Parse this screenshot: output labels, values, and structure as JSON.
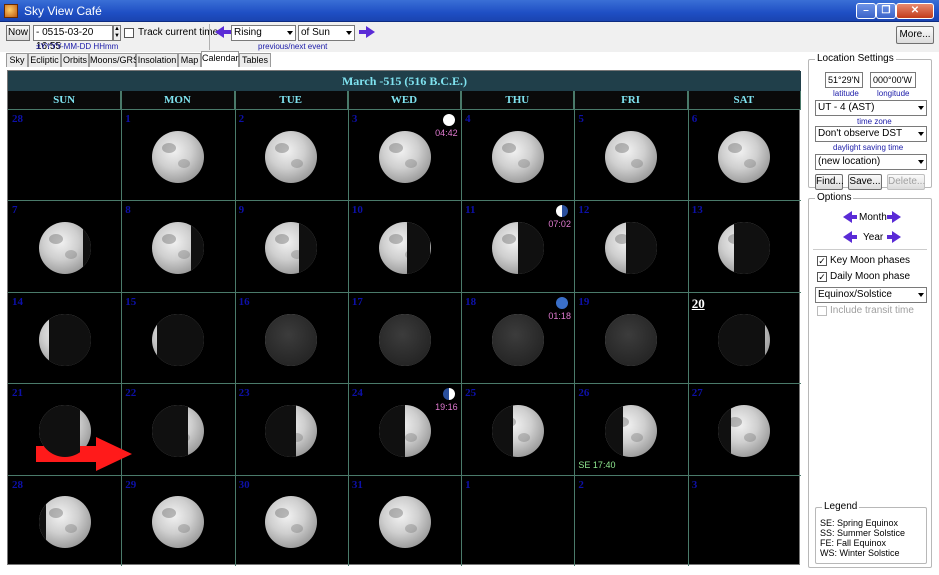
{
  "window": {
    "title": "Sky View Café",
    "min": "–",
    "max": "❐",
    "close": "✕"
  },
  "toolbar": {
    "now_label": "Now",
    "date_value": "- 0515-03-20  16:55",
    "date_hint": "±YYYY-MM-DD HHmm",
    "track_label": "Track current time",
    "event_select": "Rising",
    "body_select": "of Sun",
    "event_hint": "previous/next event",
    "more_label": "More..."
  },
  "tabs": [
    "Sky",
    "Ecliptic",
    "Orbits",
    "Moons/GRS",
    "Insolation",
    "Map",
    "Calendar",
    "Tables"
  ],
  "active_tab": "Calendar",
  "calendar": {
    "title": "March -515 (516 B.C.E.)",
    "weekdays": [
      "SUN",
      "MON",
      "TUE",
      "WED",
      "THU",
      "FRI",
      "SAT"
    ],
    "weeks": [
      [
        {
          "d": "28",
          "moon": false
        },
        {
          "d": "1",
          "moon": true,
          "lit": "full"
        },
        {
          "d": "2",
          "moon": true,
          "lit": "full"
        },
        {
          "d": "3",
          "moon": true,
          "lit": "full",
          "event": "full",
          "time": "04:42"
        },
        {
          "d": "4",
          "moon": true,
          "lit": "full"
        },
        {
          "d": "5",
          "moon": true,
          "lit": "full"
        },
        {
          "d": "6",
          "moon": true,
          "lit": "full"
        }
      ],
      [
        {
          "d": "7",
          "moon": true,
          "lit": "wan85"
        },
        {
          "d": "8",
          "moon": true,
          "lit": "wan75"
        },
        {
          "d": "9",
          "moon": true,
          "lit": "wan65"
        },
        {
          "d": "10",
          "moon": true,
          "lit": "wan55"
        },
        {
          "d": "11",
          "moon": true,
          "lit": "wan50",
          "event": "lastq",
          "time": "07:02"
        },
        {
          "d": "12",
          "moon": true,
          "lit": "wan40"
        },
        {
          "d": "13",
          "moon": true,
          "lit": "wan30"
        }
      ],
      [
        {
          "d": "14",
          "moon": true,
          "lit": "wan20"
        },
        {
          "d": "15",
          "moon": true,
          "lit": "wan10"
        },
        {
          "d": "16",
          "moon": true,
          "lit": "new"
        },
        {
          "d": "17",
          "moon": true,
          "lit": "new"
        },
        {
          "d": "18",
          "moon": true,
          "lit": "new",
          "event": "new",
          "time": "01:18"
        },
        {
          "d": "19",
          "moon": true,
          "lit": "new"
        },
        {
          "d": "20",
          "moon": true,
          "lit": "wax10",
          "today": true
        }
      ],
      [
        {
          "d": "21",
          "moon": true,
          "lit": "wax20"
        },
        {
          "d": "22",
          "moon": true,
          "lit": "wax30"
        },
        {
          "d": "23",
          "moon": true,
          "lit": "wax40"
        },
        {
          "d": "24",
          "moon": true,
          "lit": "wax50",
          "event": "firstq",
          "time": "19:16"
        },
        {
          "d": "25",
          "moon": true,
          "lit": "wax60"
        },
        {
          "d": "26",
          "moon": true,
          "lit": "wax65",
          "se": "SE 17:40"
        },
        {
          "d": "27",
          "moon": true,
          "lit": "wax75"
        }
      ],
      [
        {
          "d": "28",
          "moon": true,
          "lit": "wax85"
        },
        {
          "d": "29",
          "moon": true,
          "lit": "full"
        },
        {
          "d": "30",
          "moon": true,
          "lit": "full"
        },
        {
          "d": "31",
          "moon": true,
          "lit": "full"
        },
        {
          "d": "1",
          "moon": false
        },
        {
          "d": "2",
          "moon": false
        },
        {
          "d": "3",
          "moon": false
        }
      ]
    ]
  },
  "location": {
    "group_title": "Location Settings",
    "latitude": "51°29'N",
    "longitude": "000°00'W",
    "lat_hint": "latitude",
    "lon_hint": "longitude",
    "timezone": "UT - 4 (AST)",
    "tz_hint": "time zone",
    "dst": "Don't observe DST",
    "dst_hint": "daylight saving time",
    "location_select": "(new location)",
    "find": "Find...",
    "save": "Save...",
    "delete": "Delete..."
  },
  "options": {
    "group_title": "Options",
    "month": "Month",
    "year": "Year",
    "key_moon": "Key Moon phases",
    "daily_moon": "Daily Moon phase",
    "events_select": "Equinox/Solstice",
    "include_transit": "Include transit time"
  },
  "legend": {
    "title": "Legend",
    "lines": [
      "SE: Spring Equinox",
      "SS: Summer Solstice",
      "FE: Fall Equinox",
      "WS: Winter Solstice"
    ]
  },
  "colors": {
    "accent_arrow": "#5a2bd6",
    "highlight_arrow": "#ff1a1a",
    "calendar_text": "#7fe3f0",
    "day_number": "#0d10a8"
  }
}
